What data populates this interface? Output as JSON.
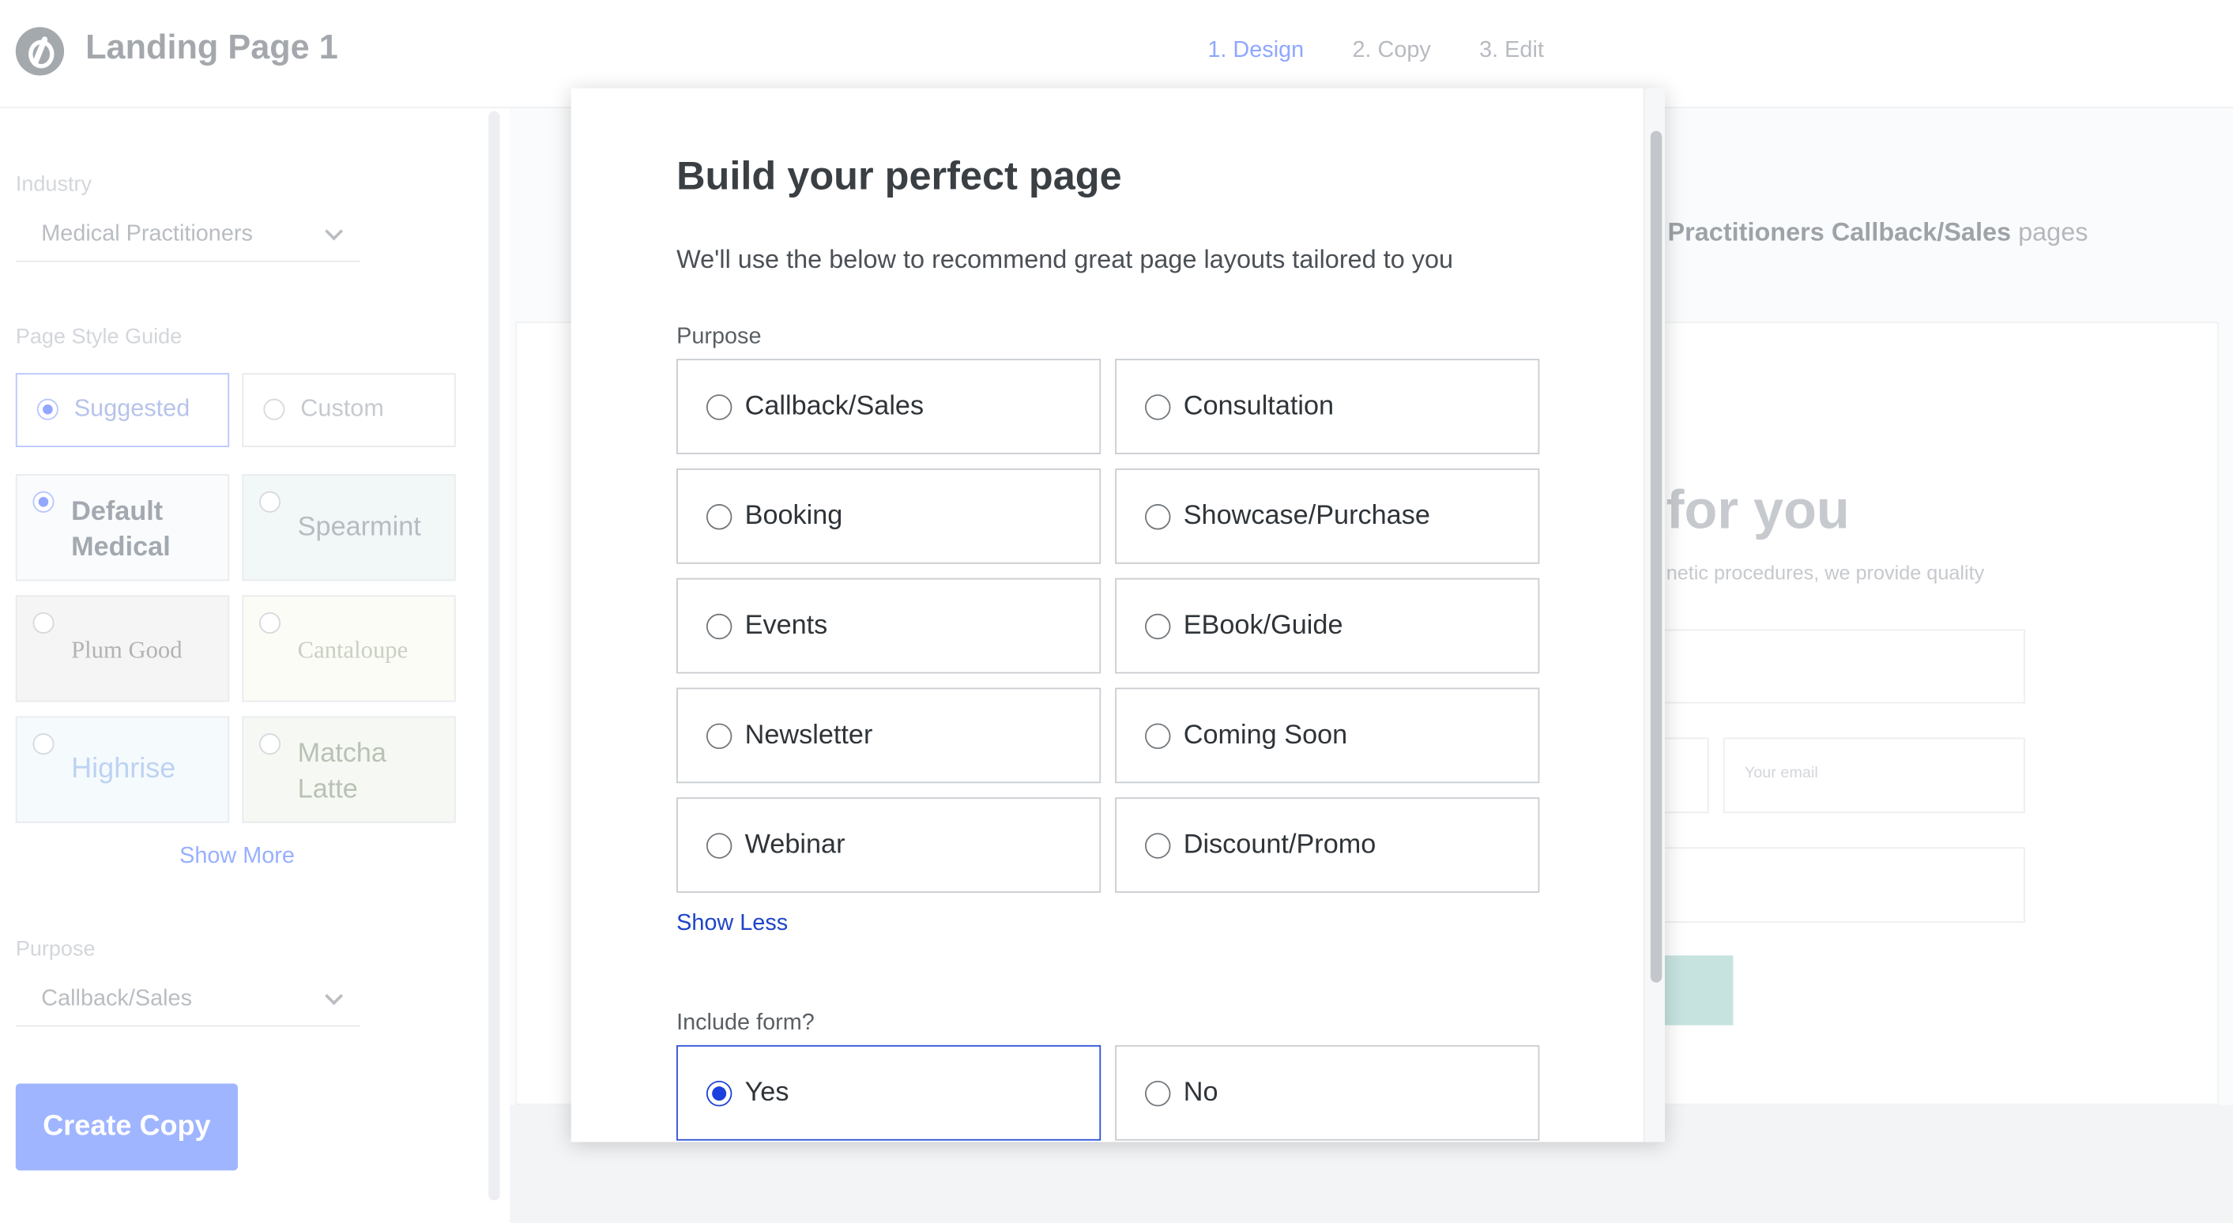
{
  "header": {
    "app_title": "Landing Page 1",
    "steps": [
      "1. Design",
      "2. Copy",
      "3. Edit"
    ],
    "active_step": 0
  },
  "sidebar": {
    "industry_label": "Industry",
    "industry_value": "Medical Practitioners",
    "style_guide_label": "Page Style Guide",
    "style_options": [
      "Suggested",
      "Custom"
    ],
    "style_selected": "Suggested",
    "themes": [
      {
        "name": "Default Medical",
        "selected": true,
        "color": "#fafbfc"
      },
      {
        "name": "Spearmint",
        "selected": false,
        "color": "#f2f8f7"
      },
      {
        "name": "Plum Good",
        "selected": false,
        "color": "#f5f5f5"
      },
      {
        "name": "Cantaloupe",
        "selected": false,
        "color": "#fbfcf5"
      },
      {
        "name": "Highrise",
        "selected": false,
        "color": "#f5fafd"
      },
      {
        "name": "Matcha Latte",
        "selected": false,
        "color": "#f6f9f3"
      }
    ],
    "show_more": "Show More",
    "purpose_label": "Purpose",
    "purpose_value": "Callback/Sales",
    "create_copy": "Create Copy"
  },
  "background": {
    "heading_bold": "Practitioners Callback/Sales",
    "heading_rest": " pages",
    "for_you": "for you",
    "subtext": "netic procedures, we provide quality",
    "email_placeholder": "Your email"
  },
  "modal": {
    "title": "Build your perfect page",
    "subtitle": "We'll use the below to recommend great page layouts tailored to you",
    "purpose_label": "Purpose",
    "purpose_options": [
      "Callback/Sales",
      "Consultation",
      "Booking",
      "Showcase/Purchase",
      "Events",
      "EBook/Guide",
      "Newsletter",
      "Coming Soon",
      "Webinar",
      "Discount/Promo"
    ],
    "show_less": "Show Less",
    "form_label": "Include form?",
    "form_options": [
      "Yes",
      "No"
    ],
    "form_selected": "Yes"
  },
  "colors": {
    "accent": "#1d3fdd",
    "link": "#1e44c8",
    "create_copy_bg": "#9fb5ff"
  }
}
